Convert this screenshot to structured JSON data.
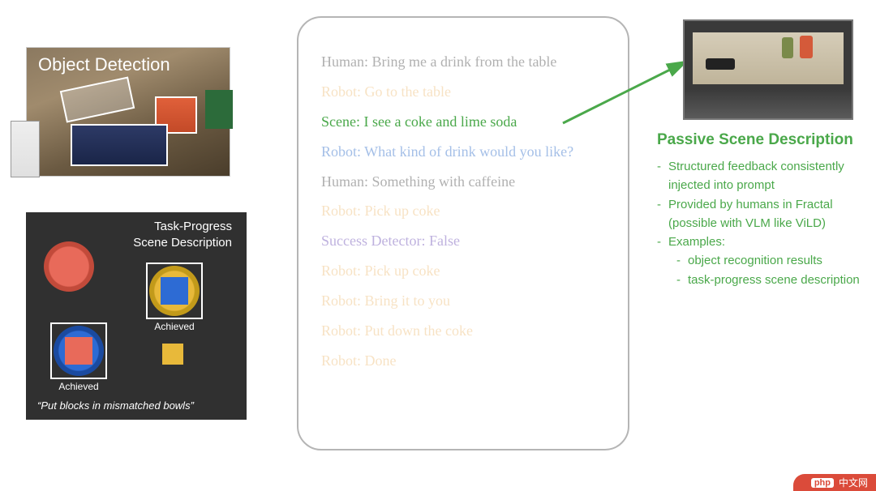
{
  "object_detection": {
    "title": "Object Detection"
  },
  "task_progress": {
    "title_line1": "Task-Progress",
    "title_line2": "Scene Description",
    "achieved_label": "Achieved",
    "caption": "“Put blocks in mismatched bowls”"
  },
  "dialog": [
    {
      "text": "Human: Bring me a drink from the table",
      "cls": "gray dim"
    },
    {
      "text": "Robot: Go to the table",
      "cls": "orange dim"
    },
    {
      "text": "Scene: I see a coke and lime soda",
      "cls": "green"
    },
    {
      "text": "Robot: What kind of drink would you like?",
      "cls": "blue dimhalf"
    },
    {
      "text": "Human: Something with caffeine",
      "cls": "gray dimhalf"
    },
    {
      "text": "Robot: Pick up coke",
      "cls": "orange dim"
    },
    {
      "text": "Success Detector: False",
      "cls": "purple dimhalf"
    },
    {
      "text": "Robot: Pick up coke",
      "cls": "orange dim"
    },
    {
      "text": "Robot: Bring it to you",
      "cls": "orange dim"
    },
    {
      "text": "Robot: Put down the coke",
      "cls": "orange dim"
    },
    {
      "text": "Robot: Done",
      "cls": "orange dim"
    }
  ],
  "right": {
    "title": "Passive Scene Description",
    "bullets": [
      "Structured feedback consistently injected into prompt",
      "Provided by humans in Fractal (possible with VLM like ViLD)",
      "Examples:"
    ],
    "sub": [
      "object recognition results",
      "task-progress scene description"
    ]
  },
  "watermark": {
    "logo": "php",
    "text": "中文网"
  }
}
